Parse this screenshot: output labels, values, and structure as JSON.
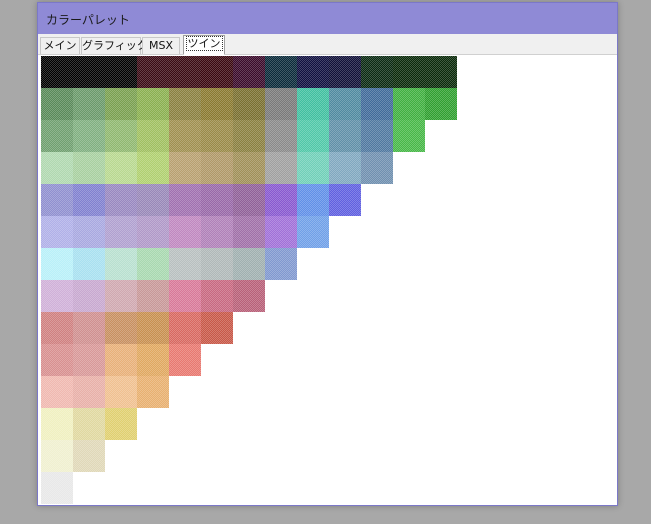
{
  "window": {
    "title": "カラーパレット"
  },
  "tabs": [
    {
      "label": "メイン",
      "active": false
    },
    {
      "label": "グラフィック",
      "active": false
    },
    {
      "label": "MSX",
      "active": false
    },
    {
      "label": "ツイン",
      "active": true
    }
  ],
  "palette": {
    "rows": [
      [
        "#000000",
        "#000000",
        "#000000",
        "#3a0a14",
        "#3a0a12",
        "#3a0810",
        "#3a0a2a",
        "#0a2a3a",
        "#101040",
        "#101038",
        "#0a2a12",
        "#0a2a0a",
        "#0a2a0a"
      ],
      [
        "#5a8a5a",
        "#6a9a6a",
        "#7aa050",
        "#8ab050",
        "#8a8040",
        "#8a7a30",
        "#7a7030",
        "#7a7a7a",
        "#40c0a0",
        "#508aa0",
        "#406a9a",
        "#40b040",
        "#30a030"
      ],
      [
        "#70a070",
        "#80b080",
        "#90b870",
        "#a0c060",
        "#a09050",
        "#9a8a48",
        "#8a8040",
        "#8a8a8a",
        "#50c8a8",
        "#6090a8",
        "#5078a0",
        "#48b848"
      ],
      [
        "#b0d8b0",
        "#a8d0a0",
        "#b8d890",
        "#b0d070",
        "#b8a070",
        "#b09868",
        "#a09058",
        "#a0a0a0",
        "#70d0b8",
        "#80a8c0",
        "#7090b0"
      ],
      [
        "#9090d0",
        "#8080d0",
        "#9888c0",
        "#9888b8",
        "#a070b0",
        "#9868a8",
        "#906098",
        "#8858d0",
        "#6090e8",
        "#6060e0"
      ],
      [
        "#b0b0e8",
        "#a8a8e0",
        "#b0a0d0",
        "#b098c8",
        "#c088c0",
        "#b080b8",
        "#a070a8",
        "#a070d8",
        "#70a0e8"
      ],
      [
        "#b8f0f8",
        "#a8e0f0",
        "#b8e0d0",
        "#a8d8b0",
        "#b8c0c0",
        "#b0b8b8",
        "#a0b0b0",
        "#8098d0"
      ],
      [
        "#d0b0d8",
        "#c8a8d0",
        "#d0a8b0",
        "#c89898",
        "#d87898",
        "#c86880",
        "#b86078"
      ],
      [
        "#d08080",
        "#d09090",
        "#c89060",
        "#c89050",
        "#d86860",
        "#c85848"
      ],
      [
        "#d89090",
        "#d89898",
        "#e8b078",
        "#e0a860",
        "#e87870"
      ],
      [
        "#f0b8b0",
        "#e8b0a8",
        "#f0c090",
        "#e8b070"
      ],
      [
        "#f0f0c0",
        "#e0d8a0",
        "#e0d070"
      ],
      [
        "#f0f0d0",
        "#e0d8b8"
      ],
      [
        "#e8e8e8"
      ]
    ]
  }
}
